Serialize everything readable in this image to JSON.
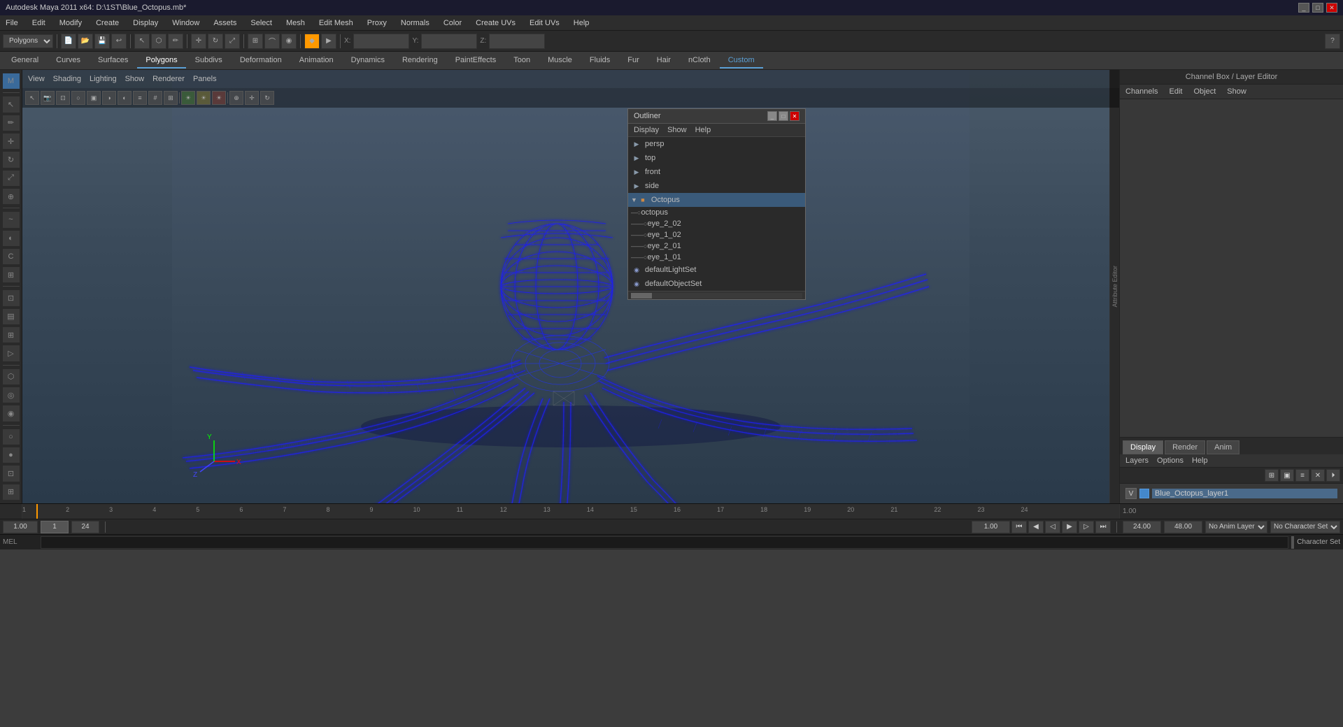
{
  "titleBar": {
    "title": "Autodesk Maya 2011 x64: D:\\1ST\\Blue_Octopus.mb*",
    "winButtons": [
      "_",
      "□",
      "✕"
    ]
  },
  "menuBar": {
    "items": [
      "File",
      "Edit",
      "Modify",
      "Create",
      "Display",
      "Window",
      "Assets",
      "Select",
      "Mesh",
      "Edit Mesh",
      "Proxy",
      "Normals",
      "Color",
      "Create UVs",
      "Edit UVs",
      "Help"
    ]
  },
  "modeSelector": {
    "value": "Polygons"
  },
  "tabs": {
    "items": [
      "General",
      "Curves",
      "Surfaces",
      "Polygons",
      "Subdivs",
      "Deformation",
      "Animation",
      "Dynamics",
      "Rendering",
      "PaintEffects",
      "Toon",
      "Muscle",
      "Fluids",
      "Fur",
      "Hair",
      "nCloth",
      "Custom"
    ]
  },
  "viewport": {
    "menuItems": [
      "View",
      "Shading",
      "Lighting",
      "Show",
      "Renderer",
      "Panels"
    ]
  },
  "outliner": {
    "title": "Outliner",
    "menu": [
      "Display",
      "Show",
      "Help"
    ],
    "items": [
      {
        "name": "persp",
        "indent": 0,
        "icon": "cam"
      },
      {
        "name": "top",
        "indent": 0,
        "icon": "cam"
      },
      {
        "name": "front",
        "indent": 0,
        "icon": "cam"
      },
      {
        "name": "side",
        "indent": 0,
        "icon": "cam"
      },
      {
        "name": "Octopus",
        "indent": 0,
        "icon": "grp",
        "selected": true
      },
      {
        "name": "octopus",
        "indent": 1,
        "icon": "mesh"
      },
      {
        "name": "eye_2_02",
        "indent": 2,
        "icon": "mesh"
      },
      {
        "name": "eye_1_02",
        "indent": 2,
        "icon": "mesh"
      },
      {
        "name": "eye_2_01",
        "indent": 2,
        "icon": "mesh"
      },
      {
        "name": "eye_1_01",
        "indent": 2,
        "icon": "mesh"
      },
      {
        "name": "defaultLightSet",
        "indent": 0,
        "icon": "set"
      },
      {
        "name": "defaultObjectSet",
        "indent": 0,
        "icon": "set"
      }
    ]
  },
  "channelBox": {
    "title": "Channel Box / Layer Editor",
    "menu": [
      "Channels",
      "Edit",
      "Object",
      "Show"
    ]
  },
  "layersPanel": {
    "tabs": [
      "Display",
      "Render",
      "Anim"
    ],
    "activeTab": "Display",
    "menu": [
      "Layers",
      "Options",
      "Help"
    ],
    "layers": [
      {
        "visible": "V",
        "name": "Blue_Octopus_layer1"
      }
    ]
  },
  "timeline": {
    "ticks": [
      "1",
      "2",
      "3",
      "4",
      "5",
      "6",
      "7",
      "8",
      "9",
      "10",
      "11",
      "12",
      "13",
      "14",
      "15",
      "16",
      "17",
      "18",
      "19",
      "20",
      "21",
      "22",
      "23",
      "24"
    ],
    "startFrame": "1.00",
    "endFrame": "24.00",
    "playStart": "24.00",
    "playEnd": "48.00"
  },
  "bottomControls": {
    "currentFrame": "1",
    "startFrame": "1.00",
    "endFrame": "1.00",
    "subFrame": "1"
  },
  "transportBar": {
    "frameField": "1.00",
    "buttons": [
      "⏮",
      "◀",
      "▶",
      "▶▶",
      "⏭"
    ],
    "loopBtn": "↻",
    "noAnimLayer": "No Anim Layer",
    "noCharSet": "No Character Set",
    "characterSet": "Character Set"
  },
  "statusBar": {
    "left": "MEL",
    "rightLabels": [
      "No Anim Layer",
      "No Character Set",
      "Character Set"
    ]
  },
  "coordinateBar": {
    "xLabel": "X:",
    "yLabel": "Y:",
    "zLabel": "Z:"
  }
}
